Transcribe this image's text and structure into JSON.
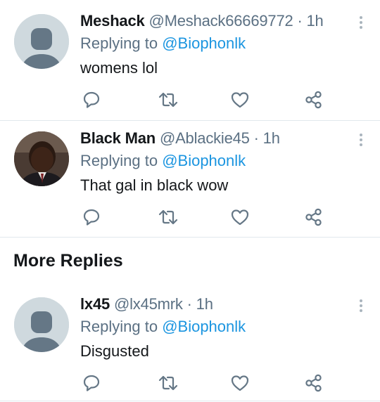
{
  "tweets": [
    {
      "display_name": "Meshack",
      "handle": "@Meshack66669772",
      "time": " · 1h",
      "replying_prefix": "Replying to ",
      "replying_to": "@Biophonlk",
      "text": "womens lol",
      "avatar": "default-avatar"
    },
    {
      "display_name": "Black Man",
      "handle": "@Ablackie45",
      "time": " · 1h",
      "replying_prefix": "Replying to ",
      "replying_to": "@Biophonlk",
      "text": "That gal in black wow",
      "avatar": "photo-avatar"
    },
    {
      "display_name": "lx45",
      "handle": "@lx45mrk",
      "time": " · 1h",
      "replying_prefix": "Replying to ",
      "replying_to": "@Biophonlk",
      "text": "Disgusted",
      "avatar": "default-avatar"
    }
  ],
  "section": {
    "title": "More Replies"
  },
  "icons": {
    "reply": "reply-icon",
    "retweet": "retweet-icon",
    "like": "like-icon",
    "share": "share-icon",
    "more": "more-vertical-icon"
  },
  "colors": {
    "link": "#1b95e0",
    "muted": "#5b7083",
    "icon": "#657786",
    "divider": "#e1e8ed"
  }
}
